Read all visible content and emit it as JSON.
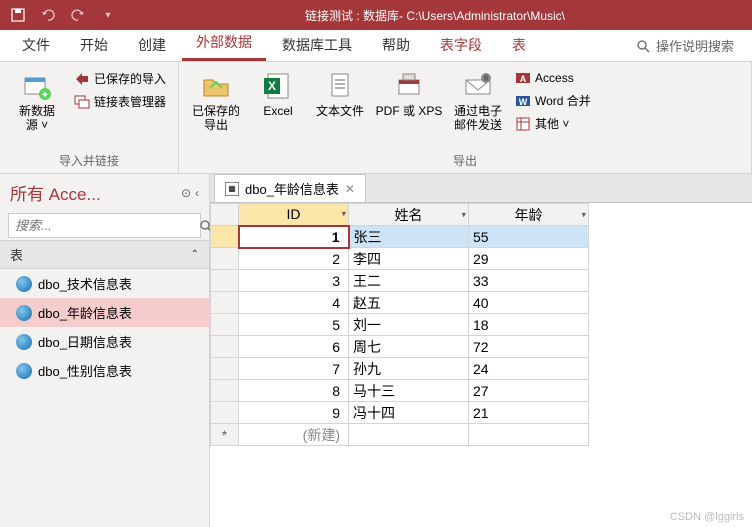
{
  "titlebar": {
    "title": "链接测试 : 数据库- C:\\Users\\Administrator\\Music\\"
  },
  "ribbonTabs": {
    "file": "文件",
    "home": "开始",
    "create": "创建",
    "external": "外部数据",
    "dbtools": "数据库工具",
    "help": "帮助",
    "tablefields": "表字段",
    "table": "表",
    "searchHint": "操作说明搜索"
  },
  "ribbon": {
    "group1": {
      "newSource": "新数据\n源 ˅",
      "savedImport": "已保存的导入",
      "linkedTableMgr": "链接表管理器",
      "label": "导入并链接"
    },
    "group2": {
      "savedExport": "已保存的\n导出",
      "excel": "Excel",
      "textFile": "文本文件",
      "pdfxps": "PDF 或 XPS",
      "email": "通过电子\n邮件发送",
      "access": "Access",
      "wordMerge": "Word 合并",
      "other": "其他 ˅",
      "label": "导出"
    }
  },
  "nav": {
    "title": "所有 Acce...",
    "searchPlaceholder": "搜索...",
    "sectionLabel": "表",
    "items": [
      {
        "label": "dbo_技术信息表",
        "selected": false
      },
      {
        "label": "dbo_年龄信息表",
        "selected": true
      },
      {
        "label": "dbo_日期信息表",
        "selected": false
      },
      {
        "label": "dbo_性别信息表",
        "selected": false
      }
    ]
  },
  "docTab": {
    "label": "dbo_年龄信息表"
  },
  "grid": {
    "columns": [
      "ID",
      "姓名",
      "年龄"
    ],
    "rows": [
      {
        "id": 1,
        "name": "张三",
        "age": 55
      },
      {
        "id": 2,
        "name": "李四",
        "age": 29
      },
      {
        "id": 3,
        "name": "王二",
        "age": 33
      },
      {
        "id": 4,
        "name": "赵五",
        "age": 40
      },
      {
        "id": 5,
        "name": "刘一",
        "age": 18
      },
      {
        "id": 6,
        "name": "周七",
        "age": 72
      },
      {
        "id": 7,
        "name": "孙九",
        "age": 24
      },
      {
        "id": 8,
        "name": "马十三",
        "age": 27
      },
      {
        "id": 9,
        "name": "冯十四",
        "age": 21
      }
    ],
    "newRowLabel": "(新建)",
    "newRowMarker": "*"
  },
  "watermark": "CSDN @lggirls"
}
